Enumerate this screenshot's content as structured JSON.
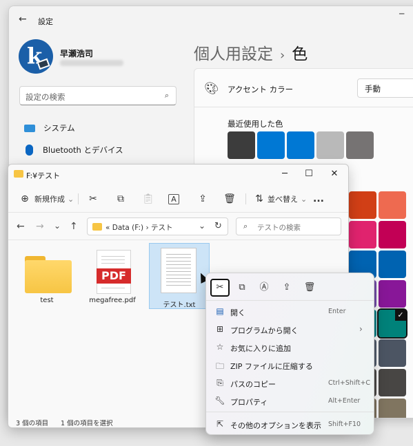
{
  "settings": {
    "title": "設定",
    "user_name": "早瀬浩司",
    "search_placeholder": "設定の検索",
    "nav": [
      {
        "label": "システム",
        "icon": "system-icon"
      },
      {
        "label": "Bluetooth とデバイス",
        "icon": "bluetooth-icon"
      }
    ],
    "page_crumb": "個人用設定",
    "page_title": "色",
    "accent_label": "アクセント カラー",
    "accent_value": "手動",
    "recent_label": "最近使用した色",
    "recent_colors": [
      "#3c3c3c",
      "#0078d4",
      "#0078d4",
      "#b9b9b9",
      "#767373"
    ],
    "grid_colors": [
      [
        "#d13f16",
        "#ee6a50"
      ],
      [
        "#e0236e",
        "#c20055"
      ],
      [
        "#0063b1",
        "#0063b1"
      ],
      [
        "#744da9",
        "#881798"
      ],
      [
        "#038387",
        "#00827a"
      ],
      [
        "#515c6b",
        "#4c5563"
      ],
      [
        "#4c4a48",
        "#484644"
      ],
      [
        "#7e735f",
        "#807560"
      ]
    ]
  },
  "explorer": {
    "title": "F:¥テスト",
    "toolbar": {
      "new_label": "新規作成",
      "sort_label": "並べ替え",
      "more_label": "..."
    },
    "address_path": "« Data (F:)  ›  テスト",
    "search_placeholder": "テストの検索",
    "files": [
      {
        "name": "test",
        "type": "folder"
      },
      {
        "name": "megafree.pdf",
        "type": "pdf",
        "badge": "PDF"
      },
      {
        "name": "テスト.txt",
        "type": "text",
        "selected": true
      }
    ],
    "status_count": "3 個の項目",
    "status_selected": "1 個の項目を選択"
  },
  "context_menu": {
    "icons": [
      "cut-icon",
      "copy-icon",
      "rename-icon",
      "share-icon",
      "delete-icon"
    ],
    "items": [
      {
        "label": "開く",
        "shortcut": "Enter",
        "icon": "open-icon"
      },
      {
        "label": "プログラムから開く",
        "shortcut": "",
        "icon": "open-with-icon",
        "submenu": true
      },
      {
        "label": "お気に入りに追加",
        "shortcut": "",
        "icon": "star-icon"
      },
      {
        "label": "ZIP ファイルに圧縮する",
        "shortcut": "",
        "icon": "zip-icon"
      },
      {
        "label": "パスのコピー",
        "shortcut": "Ctrl+Shift+C",
        "icon": "copy-path-icon"
      },
      {
        "label": "プロパティ",
        "shortcut": "Alt+Enter",
        "icon": "properties-icon"
      },
      {
        "label": "その他のオプションを表示",
        "shortcut": "Shift+F10",
        "icon": "more-options-icon"
      }
    ]
  }
}
